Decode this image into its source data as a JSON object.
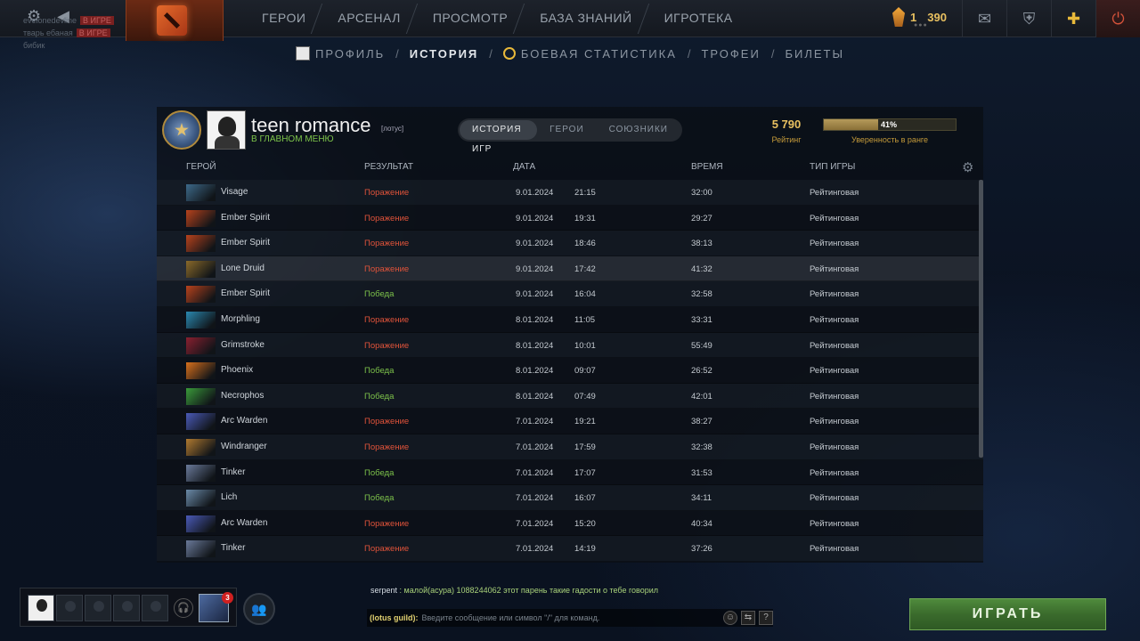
{
  "topbar": {
    "nav": [
      "ГЕРОИ",
      "АРСЕНАЛ",
      "ПРОСМОТР",
      "БАЗА ЗНАНИЙ",
      "ИГРОТЕКА"
    ],
    "currency": {
      "level": "1",
      "points": "390"
    },
    "friends_ghost": [
      {
        "name": "evelonedevline",
        "tag": "В ИГРЕ"
      },
      {
        "name": "тварь ебаная",
        "tag": "В ИГРЕ"
      },
      {
        "name": "бибик"
      }
    ]
  },
  "subnav": {
    "items": [
      "ПРОФИЛЬ",
      "ИСТОРИЯ",
      "БОЕВАЯ СТАТИСТИКА",
      "ТРОФЕИ",
      "БИЛЕТЫ"
    ],
    "active": "ИСТОРИЯ"
  },
  "profile": {
    "name": "teen romance",
    "guild": "[лотус]",
    "status": "В ГЛАВНОМ МЕНЮ",
    "tabs": [
      "ИСТОРИЯ ИГР",
      "ГЕРОИ",
      "СОЮЗНИКИ"
    ],
    "rating_value": "5 790",
    "rating_label": "Рейтинг",
    "confidence_pct": "41%",
    "confidence_fraction": 0.41,
    "confidence_label": "Уверенность в ранге"
  },
  "table": {
    "headers": [
      "ГЕРОЙ",
      "РЕЗУЛЬТАТ",
      "ДАТА",
      "ВРЕМЯ",
      "ТИП ИГРЫ"
    ],
    "rows": [
      {
        "hero": "Visage",
        "result": "Поражение",
        "date": "9.01.2024",
        "time": "21:15",
        "duration": "32:00",
        "type": "Рейтинговая",
        "win": false,
        "color": "#3d6a8a"
      },
      {
        "hero": "Ember Spirit",
        "result": "Поражение",
        "date": "9.01.2024",
        "time": "19:31",
        "duration": "29:27",
        "type": "Рейтинговая",
        "win": false,
        "color": "#b8421c"
      },
      {
        "hero": "Ember Spirit",
        "result": "Поражение",
        "date": "9.01.2024",
        "time": "18:46",
        "duration": "38:13",
        "type": "Рейтинговая",
        "win": false,
        "color": "#b8421c"
      },
      {
        "hero": "Lone Druid",
        "result": "Поражение",
        "date": "9.01.2024",
        "time": "17:42",
        "duration": "41:32",
        "type": "Рейтинговая",
        "win": false,
        "color": "#8a6a2a"
      },
      {
        "hero": "Ember Spirit",
        "result": "Победа",
        "date": "9.01.2024",
        "time": "16:04",
        "duration": "32:58",
        "type": "Рейтинговая",
        "win": true,
        "color": "#b8421c"
      },
      {
        "hero": "Morphling",
        "result": "Поражение",
        "date": "8.01.2024",
        "time": "11:05",
        "duration": "33:31",
        "type": "Рейтинговая",
        "win": false,
        "color": "#2a88b0"
      },
      {
        "hero": "Grimstroke",
        "result": "Поражение",
        "date": "8.01.2024",
        "time": "10:01",
        "duration": "55:49",
        "type": "Рейтинговая",
        "win": false,
        "color": "#8a2030"
      },
      {
        "hero": "Phoenix",
        "result": "Победа",
        "date": "8.01.2024",
        "time": "09:07",
        "duration": "26:52",
        "type": "Рейтинговая",
        "win": true,
        "color": "#d8701c"
      },
      {
        "hero": "Necrophos",
        "result": "Победа",
        "date": "8.01.2024",
        "time": "07:49",
        "duration": "42:01",
        "type": "Рейтинговая",
        "win": true,
        "color": "#3a9a3a"
      },
      {
        "hero": "Arc Warden",
        "result": "Поражение",
        "date": "7.01.2024",
        "time": "19:21",
        "duration": "38:27",
        "type": "Рейтинговая",
        "win": false,
        "color": "#4a5ab8"
      },
      {
        "hero": "Windranger",
        "result": "Поражение",
        "date": "7.01.2024",
        "time": "17:59",
        "duration": "32:38",
        "type": "Рейтинговая",
        "win": false,
        "color": "#b07a30"
      },
      {
        "hero": "Tinker",
        "result": "Победа",
        "date": "7.01.2024",
        "time": "17:07",
        "duration": "31:53",
        "type": "Рейтинговая",
        "win": true,
        "color": "#6a7a9a"
      },
      {
        "hero": "Lich",
        "result": "Победа",
        "date": "7.01.2024",
        "time": "16:07",
        "duration": "34:11",
        "type": "Рейтинговая",
        "win": true,
        "color": "#6a8aa8"
      },
      {
        "hero": "Arc Warden",
        "result": "Поражение",
        "date": "7.01.2024",
        "time": "15:20",
        "duration": "40:34",
        "type": "Рейтинговая",
        "win": false,
        "color": "#4a5ab8"
      },
      {
        "hero": "Tinker",
        "result": "Поражение",
        "date": "7.01.2024",
        "time": "14:19",
        "duration": "37:26",
        "type": "Рейтинговая",
        "win": false,
        "color": "#6a7a9a"
      }
    ],
    "highlight_index": 3
  },
  "party": {
    "notif_count": "3"
  },
  "chat": {
    "sender": "serpent",
    "message": ": малой(асура) 1088244062 этот парень такие гадости о тебе говорил",
    "channel": "(lotus guild):",
    "placeholder": "Введите сообщение или символ \"/\" для команд."
  },
  "play_label": "ИГРАТЬ",
  "colors": {
    "accent": "#e8c060",
    "loss": "#e0533a",
    "win": "#7cc14a",
    "play": "#3a6b2c"
  }
}
